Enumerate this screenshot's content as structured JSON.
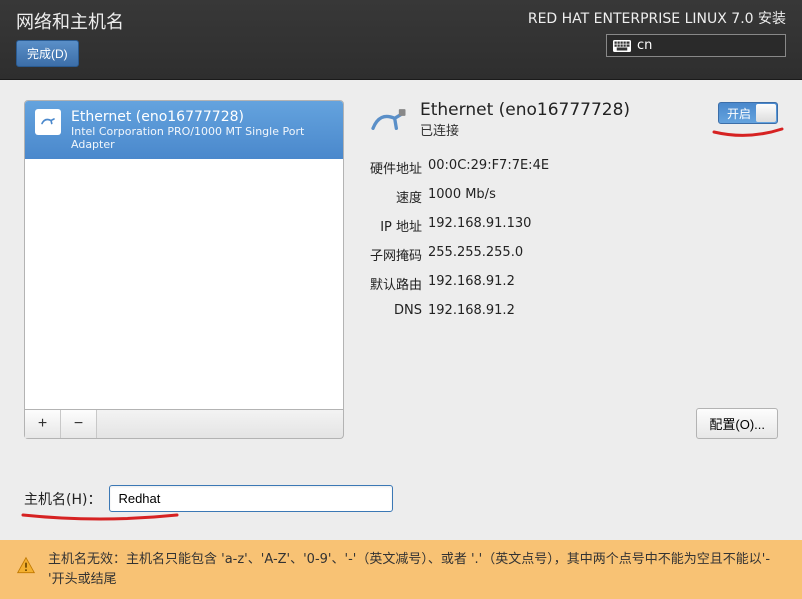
{
  "header": {
    "title": "网络和主机名",
    "done_label": "完成(D)",
    "subtitle": "RED HAT ENTERPRISE LINUX 7.0 安装",
    "lang": "cn"
  },
  "devices": {
    "selected": {
      "name": "Ethernet (eno16777728)",
      "desc": "Intel Corporation PRO/1000 MT Single Port Adapter"
    }
  },
  "toolbar": {
    "add": "+",
    "remove": "−"
  },
  "detail": {
    "title": "Ethernet (eno16777728)",
    "status": "已连接",
    "toggle_label": "开启",
    "props": {
      "hw_label": "硬件地址",
      "hw_val": "00:0C:29:F7:7E:4E",
      "speed_label": "速度",
      "speed_val": "1000 Mb/s",
      "ip_label": "IP 地址",
      "ip_val": "192.168.91.130",
      "mask_label": "子网掩码",
      "mask_val": "255.255.255.0",
      "gw_label": "默认路由",
      "gw_val": "192.168.91.2",
      "dns_label": "DNS",
      "dns_val": "192.168.91.2"
    },
    "configure_label": "配置(O)..."
  },
  "hostname": {
    "label": "主机名(H)：",
    "value": "Redhat"
  },
  "warning": {
    "text": "主机名无效：主机名只能包含 'a-z'、'A-Z'、'0-9'、'-'（英文减号）、或者 '.'（英文点号），其中两个点号中不能为空且不能以'-'开头或结尾"
  }
}
